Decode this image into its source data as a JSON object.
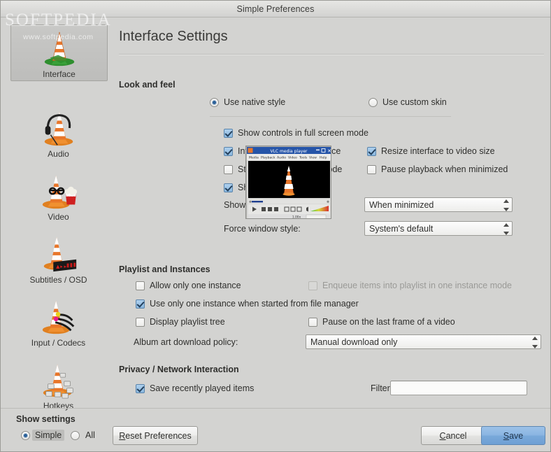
{
  "window": {
    "title": "Simple Preferences",
    "watermark": "SOFTPEDIA",
    "watermark_sub": "www.softpedia.com"
  },
  "sidebar": {
    "items": [
      {
        "label": "Interface",
        "icon": "vlc-cone-interface-icon",
        "selected": true
      },
      {
        "label": "Audio",
        "icon": "vlc-cone-headphones-icon",
        "selected": false
      },
      {
        "label": "Video",
        "icon": "vlc-cone-popcorn-icon",
        "selected": false
      },
      {
        "label": "Subtitles / OSD",
        "icon": "vlc-cone-subtitles-icon",
        "selected": false
      },
      {
        "label": "Input / Codecs",
        "icon": "vlc-cone-cables-icon",
        "selected": false
      },
      {
        "label": "Hotkeys",
        "icon": "vlc-cone-keys-icon",
        "selected": false
      }
    ]
  },
  "main": {
    "page_title": "Interface Settings",
    "groups": {
      "look_and_feel": {
        "title": "Look and feel",
        "style_radios": [
          {
            "label": "Use native style",
            "checked": true
          },
          {
            "label": "Use custom skin",
            "checked": false
          }
        ],
        "checkboxes": [
          {
            "label": "Show controls in full screen mode",
            "checked": true,
            "disabled": false
          },
          {
            "label": "Integrate video in interface",
            "checked": true,
            "disabled": false
          },
          {
            "label": "Resize interface to video size",
            "checked": true,
            "disabled": false
          },
          {
            "label": "Start in minimal view mode",
            "checked": false,
            "disabled": false
          },
          {
            "label": "Pause playback when minimized",
            "checked": false,
            "disabled": false
          },
          {
            "label": "Show systray icon",
            "checked": true,
            "disabled": false
          }
        ],
        "media_popup_label": "Show media change popup:",
        "media_popup_value": "When minimized",
        "window_style_label": "Force window style:",
        "window_style_value": "System's default"
      },
      "playlist_and_instances": {
        "title": "Playlist and Instances",
        "checkboxes": [
          {
            "label": "Allow only one instance",
            "checked": false,
            "disabled": false
          },
          {
            "label": "Enqueue items into playlist in one instance mode",
            "checked": false,
            "disabled": true
          },
          {
            "label": "Use only one instance when started from file manager",
            "checked": true,
            "disabled": false
          },
          {
            "label": "Display playlist tree",
            "checked": false,
            "disabled": false
          },
          {
            "label": "Pause on the last frame of a video",
            "checked": false,
            "disabled": false
          }
        ],
        "album_art_label": "Album art download policy:",
        "album_art_value": "Manual download only"
      },
      "privacy": {
        "title": "Privacy / Network Interaction",
        "save_recent": {
          "label": "Save recently played items",
          "checked": true
        },
        "filter_label": "Filter:",
        "filter_value": "",
        "filter_placeholder": ""
      }
    }
  },
  "bottom": {
    "show_settings_label": "Show settings",
    "mode_radios": [
      {
        "label": "Simple",
        "checked": true
      },
      {
        "label": "All",
        "checked": false
      }
    ],
    "reset_label": "Reset Preferences",
    "reset_accel": "R",
    "cancel_label": "Cancel",
    "cancel_accel": "C",
    "save_label": "Save",
    "save_accel": "S"
  },
  "preview": {
    "window_title": "VLC media player",
    "menu_items": [
      "Media",
      "Playback",
      "Audio",
      "Video",
      "Tools",
      "View",
      "Help"
    ],
    "time_label": "1.00x"
  },
  "colors": {
    "background": "#d3d3d1",
    "accent_blue": "#2a6099",
    "checkbox_fill": "#8bb8df",
    "primary_button": "#8ab5e2",
    "text": "#2f2f2d",
    "disabled_text": "#9a9a97"
  }
}
